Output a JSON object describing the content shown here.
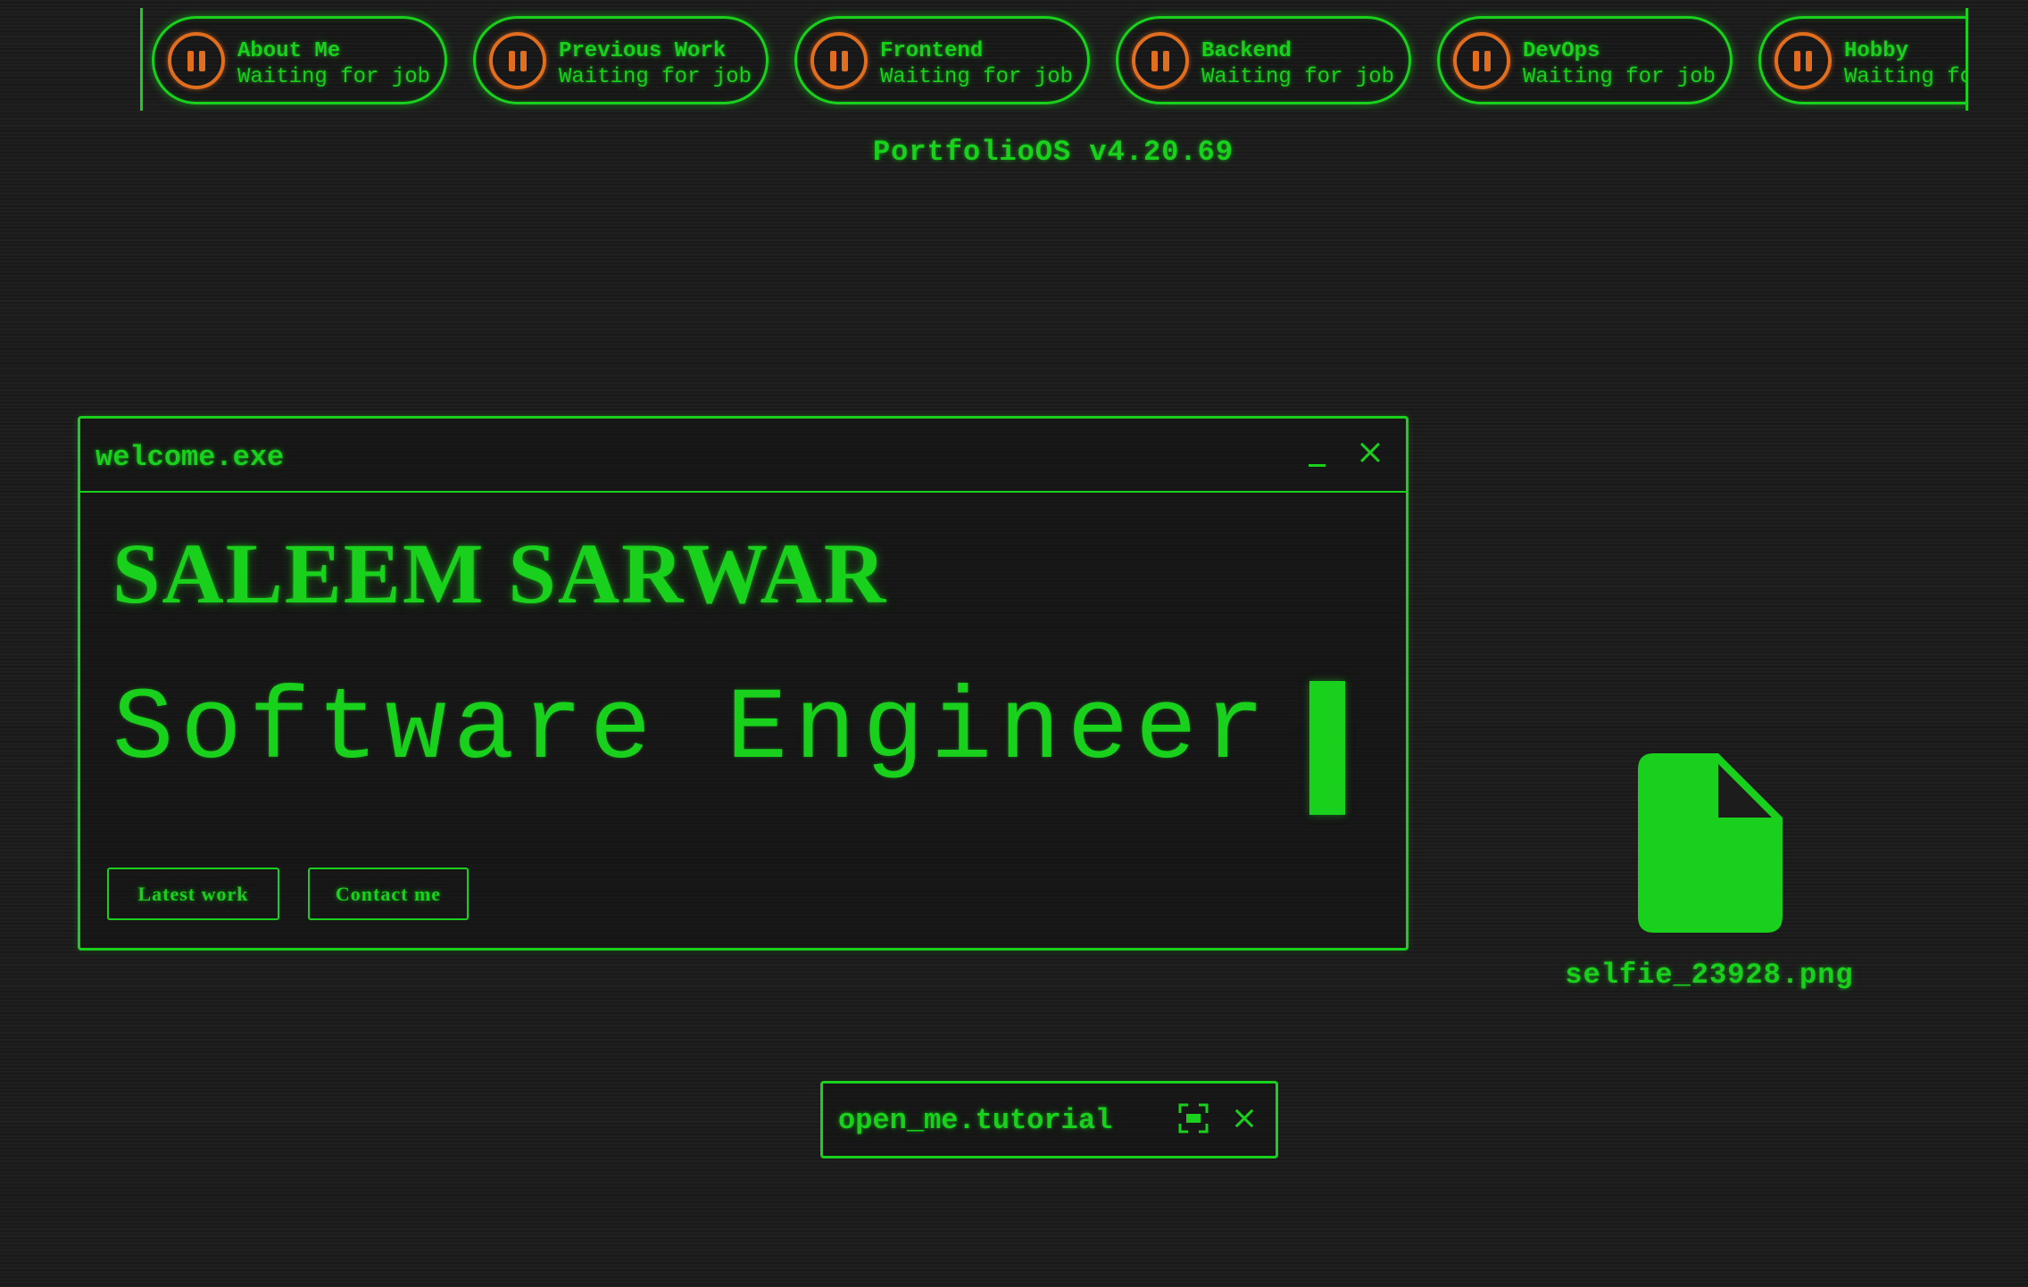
{
  "taskbar": {
    "tasks": [
      {
        "title": "About Me",
        "status": "Waiting for job"
      },
      {
        "title": "Previous Work",
        "status": "Waiting for job"
      },
      {
        "title": "Frontend",
        "status": "Waiting for job"
      },
      {
        "title": "Backend",
        "status": "Waiting for job"
      },
      {
        "title": "DevOps",
        "status": "Waiting for job"
      },
      {
        "title": "Hobby",
        "status": "Waiting for job"
      }
    ]
  },
  "os_version": "PortfolioOS v4.20.69",
  "welcome_window": {
    "title": "welcome.exe",
    "name": "SALEEM SARWAR",
    "role": "Software Engineer",
    "buttons": {
      "latest_work": "Latest work",
      "contact_me": "Contact me"
    }
  },
  "desktop_file": {
    "label": "selfie_23928.png",
    "icon": "file-icon"
  },
  "tutorial_window": {
    "title": "open_me.tutorial"
  },
  "colors": {
    "accent": "#19d01c",
    "pause_icon": "#e06e1e",
    "background": "#1c1c1c"
  }
}
